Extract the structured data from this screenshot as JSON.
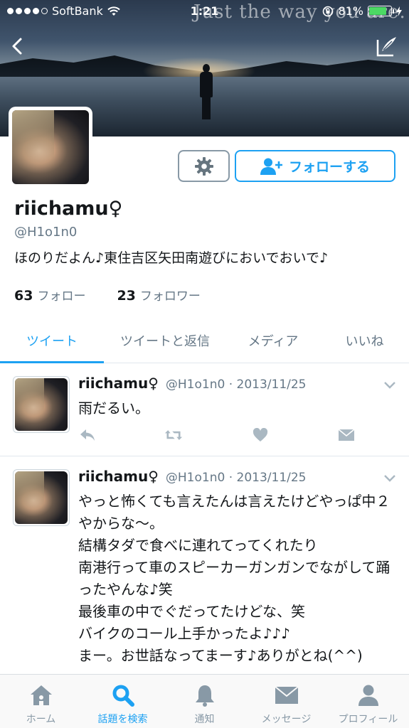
{
  "status_bar": {
    "carrier": "SoftBank",
    "time": "1:21",
    "battery": "81%",
    "battery_level": 0.81
  },
  "header": {
    "watermark": "Just the way you are."
  },
  "profile": {
    "display_name": "riichamu♀",
    "handle": "@H1o1n0",
    "bio": "ほのりだよん♪東住吉区矢田南遊びにおいでおいで♪",
    "following_count": "63",
    "following_label": "フォロー",
    "followers_count": "23",
    "followers_label": "フォロワー",
    "follow_button_label": "フォローする"
  },
  "tabs": [
    {
      "label": "ツイート",
      "active": true
    },
    {
      "label": "ツイートと返信",
      "active": false
    },
    {
      "label": "メディア",
      "active": false
    },
    {
      "label": "いいね",
      "active": false
    }
  ],
  "tweets": [
    {
      "name": "riichamu♀",
      "meta": "@H1o1n0 · 2013/11/25",
      "text": "雨だるい。"
    },
    {
      "name": "riichamu♀",
      "meta": "@H1o1n0 · 2013/11/25",
      "text": "やっと怖くても言えたんは言えたけどやっぱ中２やからな〜。\n結構タダで食べに連れてってくれたり\n南港行って車のスピーカーガンガンでながして踊ったやんな♪笑\n最後車の中でぐだってたけどな、笑\nバイクのコール上手かったよ♪♪♪\nまー。お世話なってまーす♪ありがとね(^^)"
    }
  ],
  "bottom_nav": [
    {
      "label": "ホーム",
      "icon": "home-icon",
      "active": false
    },
    {
      "label": "話題を検索",
      "icon": "search-icon",
      "active": true
    },
    {
      "label": "通知",
      "icon": "bell-icon",
      "active": false
    },
    {
      "label": "メッセージ",
      "icon": "envelope-icon",
      "active": false
    },
    {
      "label": "プロフィール",
      "icon": "person-icon",
      "active": false
    }
  ],
  "colors": {
    "accent": "#1da1f2",
    "muted": "#657786",
    "battery": "#4cd964"
  }
}
